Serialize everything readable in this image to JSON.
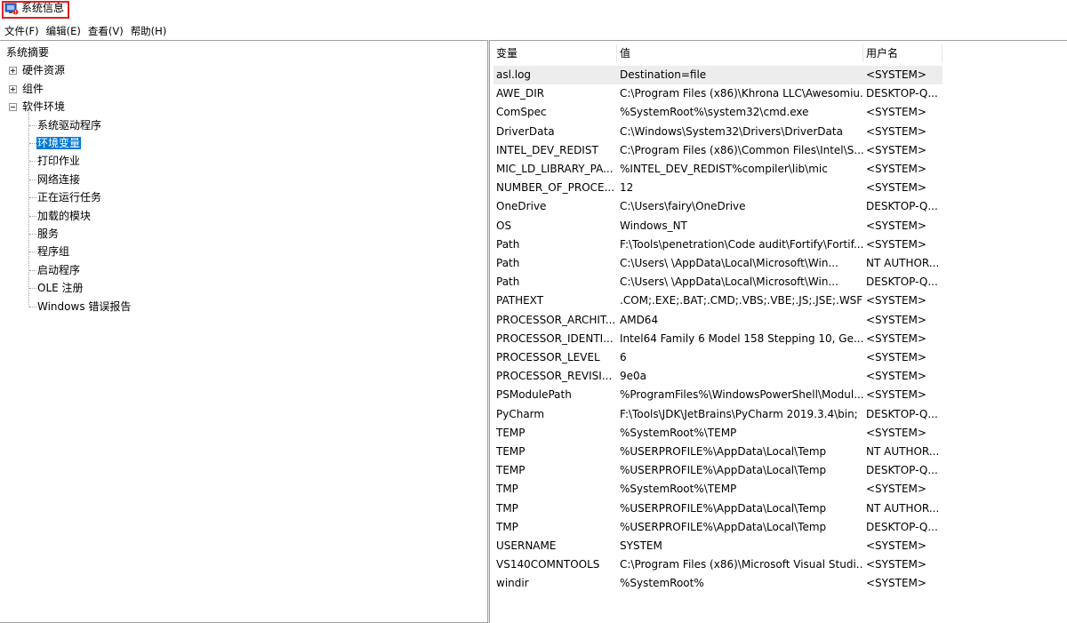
{
  "window": {
    "title": "系统信息",
    "icon": "system-information-icon"
  },
  "menu": [
    "文件(F)",
    "编辑(E)",
    "查看(V)",
    "帮助(H)"
  ],
  "tree": {
    "root": "系统摘要",
    "nodes": [
      {
        "label": "硬件资源",
        "expander": "plus"
      },
      {
        "label": "组件",
        "expander": "plus"
      },
      {
        "label": "软件环境",
        "expander": "minus"
      }
    ],
    "children": [
      "系统驱动程序",
      "环境变量",
      "打印作业",
      "网络连接",
      "正在运行任务",
      "加载的模块",
      "服务",
      "程序组",
      "启动程序",
      "OLE 注册",
      "Windows 错误报告"
    ],
    "selected_child": "环境变量"
  },
  "table": {
    "columns": [
      "变量",
      "值",
      "用户名"
    ],
    "selected_row": 0,
    "rows": [
      [
        "asl.log",
        "Destination=file",
        "<SYSTEM>"
      ],
      [
        "AWE_DIR",
        "C:\\Program Files (x86)\\Khrona LLC\\Awesomiu...",
        "DESKTOP-Q..."
      ],
      [
        "ComSpec",
        "%SystemRoot%\\system32\\cmd.exe",
        "<SYSTEM>"
      ],
      [
        "DriverData",
        "C:\\Windows\\System32\\Drivers\\DriverData",
        "<SYSTEM>"
      ],
      [
        "INTEL_DEV_REDIST",
        "C:\\Program Files (x86)\\Common Files\\Intel\\S...",
        "<SYSTEM>"
      ],
      [
        "MIC_LD_LIBRARY_PA...",
        "%INTEL_DEV_REDIST%compiler\\lib\\mic",
        "<SYSTEM>"
      ],
      [
        "NUMBER_OF_PROCE...",
        "12",
        "<SYSTEM>"
      ],
      [
        "OneDrive",
        "C:\\Users\\fairy\\OneDrive",
        "DESKTOP-Q..."
      ],
      [
        "OS",
        "Windows_NT",
        "<SYSTEM>"
      ],
      [
        "Path",
        "F:\\Tools\\penetration\\Code audit\\Fortify\\Fortif...",
        "<SYSTEM>"
      ],
      [
        "Path",
        "C:\\Users\\    \\AppData\\Local\\Microsoft\\Win...",
        "NT AUTHOR..."
      ],
      [
        "Path",
        "C:\\Users\\    \\AppData\\Local\\Microsoft\\Win...",
        "DESKTOP-Q..."
      ],
      [
        "PATHEXT",
        ".COM;.EXE;.BAT;.CMD;.VBS;.VBE;.JS;.JSE;.WSF;....",
        "<SYSTEM>"
      ],
      [
        "PROCESSOR_ARCHIT...",
        "AMD64",
        "<SYSTEM>"
      ],
      [
        "PROCESSOR_IDENTI...",
        "Intel64 Family 6 Model 158 Stepping 10, Ge...",
        "<SYSTEM>"
      ],
      [
        "PROCESSOR_LEVEL",
        "6",
        "<SYSTEM>"
      ],
      [
        "PROCESSOR_REVISI...",
        "9e0a",
        "<SYSTEM>"
      ],
      [
        "PSModulePath",
        "%ProgramFiles%\\WindowsPowerShell\\Modul...",
        "<SYSTEM>"
      ],
      [
        "PyCharm",
        "F:\\Tools\\JDK\\JetBrains\\PyCharm 2019.3.4\\bin;",
        "DESKTOP-Q..."
      ],
      [
        "TEMP",
        "%SystemRoot%\\TEMP",
        "<SYSTEM>"
      ],
      [
        "TEMP",
        "%USERPROFILE%\\AppData\\Local\\Temp",
        "NT AUTHOR..."
      ],
      [
        "TEMP",
        "%USERPROFILE%\\AppData\\Local\\Temp",
        "DESKTOP-Q..."
      ],
      [
        "TMP",
        "%SystemRoot%\\TEMP",
        "<SYSTEM>"
      ],
      [
        "TMP",
        "%USERPROFILE%\\AppData\\Local\\Temp",
        "NT AUTHOR..."
      ],
      [
        "TMP",
        "%USERPROFILE%\\AppData\\Local\\Temp",
        "DESKTOP-Q..."
      ],
      [
        "USERNAME",
        "SYSTEM",
        "<SYSTEM>"
      ],
      [
        "VS140COMNTOOLS",
        "C:\\Program Files (x86)\\Microsoft Visual Studi...",
        "<SYSTEM>"
      ],
      [
        "windir",
        "%SystemRoot%",
        "<SYSTEM>"
      ]
    ]
  },
  "colors": {
    "selection": "#0078d7",
    "row_highlight": "#ededed",
    "title_outline": "#e02020"
  }
}
